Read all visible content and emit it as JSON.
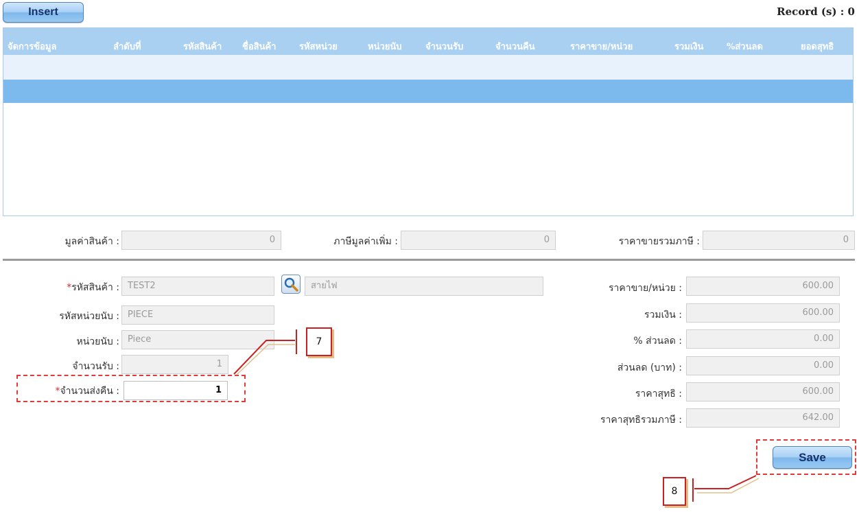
{
  "toolbar": {
    "insert_label": "Insert",
    "record_label": "Record (s) : 0"
  },
  "grid": {
    "columns": [
      "จัดการข้อมูล",
      "ลำดับที่",
      "รหัสสินค้า",
      "ชื่อสินค้า",
      "รหัสหน่วย",
      "หน่วยนับ",
      "จำนวนรับ",
      "จำนวนคืน",
      "ราคาขาย/หน่วย",
      "รวมเงิน",
      "%ส่วนลด",
      "ยอดสุทธิ"
    ]
  },
  "summary": {
    "product_value_label": "มูลค่าสินค้า :",
    "product_value": "0",
    "vat_label": "ภาษีมูลค่าเพิ่ม :",
    "vat": "0",
    "total_incl_vat_label": "ราคาขายรวมภาษี :",
    "total_incl_vat": "0"
  },
  "form": {
    "product_code_label": "รหัสสินค้า :",
    "product_code": "TEST2",
    "product_name": "สายไฟ",
    "unit_code_label": "รหัสหน่วยนับ :",
    "unit_code": "PIECE",
    "unit_label": "หน่วยนับ :",
    "unit": "Piece",
    "received_qty_label": "จำนวนรับ :",
    "received_qty": "1",
    "return_qty_label": "จำนวนส่งคืน :",
    "return_qty": "1",
    "price_per_unit_label": "ราคาขาย/หน่วย :",
    "price_per_unit": "600.00",
    "total_label": "รวมเงิน :",
    "total": "600.00",
    "discount_pct_label": "% ส่วนลด :",
    "discount_pct": "0.00",
    "discount_baht_label": "ส่วนลด (บาท) :",
    "discount_baht": "0.00",
    "net_price_label": "ราคาสุทธิ :",
    "net_price": "600.00",
    "net_incl_vat_label": "ราคาสุทธิรวมภาษี :",
    "net_incl_vat": "642.00",
    "required_mark": "*"
  },
  "actions": {
    "save_label": "Save"
  },
  "callouts": {
    "step7": "7",
    "step8": "8"
  },
  "colors": {
    "header_bg": "#a9d0f1",
    "selected_row": "#7cb9ec",
    "annotation_red": "#cc2020"
  }
}
